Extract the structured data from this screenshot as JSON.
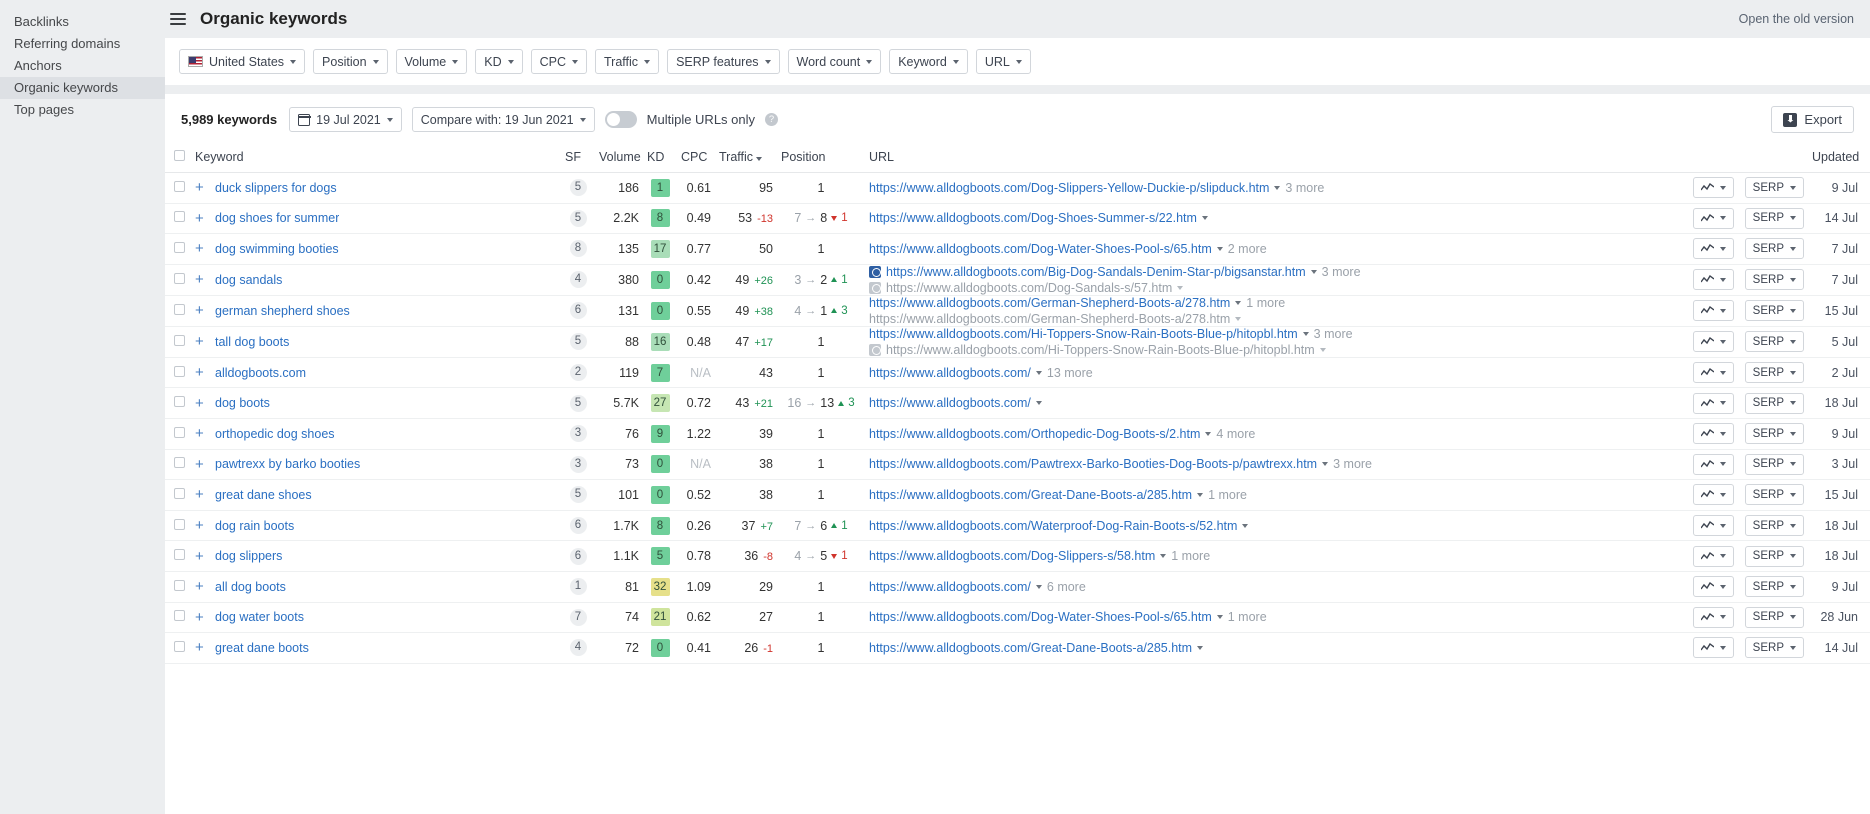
{
  "sidebar": {
    "items": [
      {
        "label": "Backlinks",
        "active": false
      },
      {
        "label": "Referring domains",
        "active": false
      },
      {
        "label": "Anchors",
        "active": false
      },
      {
        "label": "Organic keywords",
        "active": true
      },
      {
        "label": "Top pages",
        "active": false
      }
    ]
  },
  "header": {
    "title": "Organic keywords",
    "old_version_link": "Open the old version"
  },
  "filters": [
    {
      "label": "United States",
      "icon": "us-flag-icon",
      "name": "country"
    },
    {
      "label": "Position",
      "name": "position"
    },
    {
      "label": "Volume",
      "name": "volume"
    },
    {
      "label": "KD",
      "name": "kd"
    },
    {
      "label": "CPC",
      "name": "cpc"
    },
    {
      "label": "Traffic",
      "name": "traffic"
    },
    {
      "label": "SERP features",
      "name": "serp-features"
    },
    {
      "label": "Word count",
      "name": "word-count"
    },
    {
      "label": "Keyword",
      "name": "keyword"
    },
    {
      "label": "URL",
      "name": "url"
    }
  ],
  "toolbar": {
    "keyword_count": "5,989 keywords",
    "date": "19 Jul 2021",
    "compare": "Compare with: 19 Jun 2021",
    "multiple_urls_label": "Multiple URLs only",
    "multiple_urls_on": false,
    "export_label": "Export"
  },
  "table": {
    "columns": [
      {
        "key": "keyword",
        "label": "Keyword"
      },
      {
        "key": "sf",
        "label": "SF"
      },
      {
        "key": "volume",
        "label": "Volume"
      },
      {
        "key": "kd",
        "label": "KD"
      },
      {
        "key": "cpc",
        "label": "CPC"
      },
      {
        "key": "traffic",
        "label": "Traffic",
        "sorted": true
      },
      {
        "key": "position",
        "label": "Position"
      },
      {
        "key": "url",
        "label": "URL"
      },
      {
        "key": "updated",
        "label": "Updated"
      }
    ],
    "serp_button_label": "SERP",
    "rows": [
      {
        "keyword": "duck slippers for dogs",
        "sf": "5",
        "volume": "186",
        "kd": "1",
        "kd_color": "#6fcf9a",
        "cpc": "0.61",
        "traffic": "95",
        "traffic_delta": "",
        "traffic_delta_dir": "",
        "pos_from": "",
        "pos_to": "1",
        "pos_change": "",
        "pos_change_dir": "",
        "urls": [
          {
            "text": "https://www.alldogboots.com/Dog-Slippers-Yellow-Duckie-p/slipduck.htm",
            "more": "3 more",
            "serp_icon": "none",
            "muted": false
          }
        ],
        "updated": "9 Jul"
      },
      {
        "keyword": "dog shoes for summer",
        "sf": "5",
        "volume": "2.2K",
        "kd": "8",
        "kd_color": "#6fcf9a",
        "cpc": "0.49",
        "traffic": "53",
        "traffic_delta": "-13",
        "traffic_delta_dir": "down",
        "pos_from": "7",
        "pos_to": "8",
        "pos_change": "1",
        "pos_change_dir": "down",
        "urls": [
          {
            "text": "https://www.alldogboots.com/Dog-Shoes-Summer-s/22.htm",
            "more": "",
            "serp_icon": "none",
            "muted": false
          }
        ],
        "updated": "14 Jul"
      },
      {
        "keyword": "dog swimming booties",
        "sf": "8",
        "volume": "135",
        "kd": "17",
        "kd_color": "#a9ddb8",
        "cpc": "0.77",
        "traffic": "50",
        "traffic_delta": "",
        "traffic_delta_dir": "",
        "pos_from": "",
        "pos_to": "1",
        "pos_change": "",
        "pos_change_dir": "",
        "urls": [
          {
            "text": "https://www.alldogboots.com/Dog-Water-Shoes-Pool-s/65.htm",
            "more": "2 more",
            "serp_icon": "none",
            "muted": false
          }
        ],
        "updated": "7 Jul"
      },
      {
        "keyword": "dog sandals",
        "sf": "4",
        "volume": "380",
        "kd": "0",
        "kd_color": "#6fcf9a",
        "cpc": "0.42",
        "traffic": "49",
        "traffic_delta": "+26",
        "traffic_delta_dir": "up",
        "pos_from": "3",
        "pos_to": "2",
        "pos_change": "1",
        "pos_change_dir": "up",
        "urls": [
          {
            "text": "https://www.alldogboots.com/Big-Dog-Sandals-Denim-Star-p/bigsanstar.htm",
            "more": "3 more",
            "serp_icon": "blue",
            "muted": false
          },
          {
            "text": "https://www.alldogboots.com/Dog-Sandals-s/57.htm",
            "more": "",
            "serp_icon": "grey",
            "muted": true
          }
        ],
        "updated": "7 Jul"
      },
      {
        "keyword": "german shepherd shoes",
        "sf": "6",
        "volume": "131",
        "kd": "0",
        "kd_color": "#6fcf9a",
        "cpc": "0.55",
        "traffic": "49",
        "traffic_delta": "+38",
        "traffic_delta_dir": "up",
        "pos_from": "4",
        "pos_to": "1",
        "pos_change": "3",
        "pos_change_dir": "up",
        "urls": [
          {
            "text": "https://www.alldogboots.com/German-Shepherd-Boots-a/278.htm",
            "more": "1 more",
            "serp_icon": "none",
            "muted": false
          },
          {
            "text": "https://www.alldogboots.com/German-Shepherd-Boots-a/278.htm",
            "more": "",
            "serp_icon": "none",
            "muted": true
          }
        ],
        "updated": "15 Jul"
      },
      {
        "keyword": "tall dog boots",
        "sf": "5",
        "volume": "88",
        "kd": "16",
        "kd_color": "#a9ddb8",
        "cpc": "0.48",
        "traffic": "47",
        "traffic_delta": "+17",
        "traffic_delta_dir": "up",
        "pos_from": "",
        "pos_to": "1",
        "pos_change": "",
        "pos_change_dir": "",
        "urls": [
          {
            "text": "https://www.alldogboots.com/Hi-Toppers-Snow-Rain-Boots-Blue-p/hitopbl.htm",
            "more": "3 more",
            "serp_icon": "none",
            "muted": false
          },
          {
            "text": "https://www.alldogboots.com/Hi-Toppers-Snow-Rain-Boots-Blue-p/hitopbl.htm",
            "more": "",
            "serp_icon": "grey",
            "muted": true
          }
        ],
        "updated": "5 Jul"
      },
      {
        "keyword": "alldogboots.com",
        "sf": "2",
        "volume": "119",
        "kd": "7",
        "kd_color": "#6fcf9a",
        "cpc": "N/A",
        "traffic": "43",
        "traffic_delta": "",
        "traffic_delta_dir": "",
        "pos_from": "",
        "pos_to": "1",
        "pos_change": "",
        "pos_change_dir": "",
        "urls": [
          {
            "text": "https://www.alldogboots.com/",
            "more": "13 more",
            "serp_icon": "none",
            "muted": false
          }
        ],
        "updated": "2 Jul"
      },
      {
        "keyword": "dog boots",
        "sf": "5",
        "volume": "5.7K",
        "kd": "27",
        "kd_color": "#c6e6b3",
        "cpc": "0.72",
        "traffic": "43",
        "traffic_delta": "+21",
        "traffic_delta_dir": "up",
        "pos_from": "16",
        "pos_to": "13",
        "pos_change": "3",
        "pos_change_dir": "up",
        "urls": [
          {
            "text": "https://www.alldogboots.com/",
            "more": "",
            "serp_icon": "none",
            "muted": false
          }
        ],
        "updated": "18 Jul"
      },
      {
        "keyword": "orthopedic dog shoes",
        "sf": "3",
        "volume": "76",
        "kd": "9",
        "kd_color": "#6fcf9a",
        "cpc": "1.22",
        "traffic": "39",
        "traffic_delta": "",
        "traffic_delta_dir": "",
        "pos_from": "",
        "pos_to": "1",
        "pos_change": "",
        "pos_change_dir": "",
        "urls": [
          {
            "text": "https://www.alldogboots.com/Orthopedic-Dog-Boots-s/2.htm",
            "more": "4 more",
            "serp_icon": "none",
            "muted": false
          }
        ],
        "updated": "9 Jul"
      },
      {
        "keyword": "pawtrexx by barko booties",
        "sf": "3",
        "volume": "73",
        "kd": "0",
        "kd_color": "#6fcf9a",
        "cpc": "N/A",
        "traffic": "38",
        "traffic_delta": "",
        "traffic_delta_dir": "",
        "pos_from": "",
        "pos_to": "1",
        "pos_change": "",
        "pos_change_dir": "",
        "urls": [
          {
            "text": "https://www.alldogboots.com/Pawtrexx-Barko-Booties-Dog-Boots-p/pawtrexx.htm",
            "more": "3 more",
            "serp_icon": "none",
            "muted": false
          }
        ],
        "updated": "3 Jul"
      },
      {
        "keyword": "great dane shoes",
        "sf": "5",
        "volume": "101",
        "kd": "0",
        "kd_color": "#6fcf9a",
        "cpc": "0.52",
        "traffic": "38",
        "traffic_delta": "",
        "traffic_delta_dir": "",
        "pos_from": "",
        "pos_to": "1",
        "pos_change": "",
        "pos_change_dir": "",
        "urls": [
          {
            "text": "https://www.alldogboots.com/Great-Dane-Boots-a/285.htm",
            "more": "1 more",
            "serp_icon": "none",
            "muted": false
          }
        ],
        "updated": "15 Jul"
      },
      {
        "keyword": "dog rain boots",
        "sf": "6",
        "volume": "1.7K",
        "kd": "8",
        "kd_color": "#6fcf9a",
        "cpc": "0.26",
        "traffic": "37",
        "traffic_delta": "+7",
        "traffic_delta_dir": "up",
        "pos_from": "7",
        "pos_to": "6",
        "pos_change": "1",
        "pos_change_dir": "up",
        "urls": [
          {
            "text": "https://www.alldogboots.com/Waterproof-Dog-Rain-Boots-s/52.htm",
            "more": "",
            "serp_icon": "none",
            "muted": false
          }
        ],
        "updated": "18 Jul"
      },
      {
        "keyword": "dog slippers",
        "sf": "6",
        "volume": "1.1K",
        "kd": "5",
        "kd_color": "#6fcf9a",
        "cpc": "0.78",
        "traffic": "36",
        "traffic_delta": "-8",
        "traffic_delta_dir": "down",
        "pos_from": "4",
        "pos_to": "5",
        "pos_change": "1",
        "pos_change_dir": "down",
        "urls": [
          {
            "text": "https://www.alldogboots.com/Dog-Slippers-s/58.htm",
            "more": "1 more",
            "serp_icon": "none",
            "muted": false
          }
        ],
        "updated": "18 Jul"
      },
      {
        "keyword": "all dog boots",
        "sf": "1",
        "volume": "81",
        "kd": "32",
        "kd_color": "#e6e08a",
        "cpc": "1.09",
        "traffic": "29",
        "traffic_delta": "",
        "traffic_delta_dir": "",
        "pos_from": "",
        "pos_to": "1",
        "pos_change": "",
        "pos_change_dir": "",
        "urls": [
          {
            "text": "https://www.alldogboots.com/",
            "more": "6 more",
            "serp_icon": "none",
            "muted": false
          }
        ],
        "updated": "9 Jul"
      },
      {
        "keyword": "dog water boots",
        "sf": "7",
        "volume": "74",
        "kd": "21",
        "kd_color": "#cfe49c",
        "cpc": "0.62",
        "traffic": "27",
        "traffic_delta": "",
        "traffic_delta_dir": "",
        "pos_from": "",
        "pos_to": "1",
        "pos_change": "",
        "pos_change_dir": "",
        "urls": [
          {
            "text": "https://www.alldogboots.com/Dog-Water-Shoes-Pool-s/65.htm",
            "more": "1 more",
            "serp_icon": "none",
            "muted": false
          }
        ],
        "updated": "28 Jun"
      },
      {
        "keyword": "great dane boots",
        "sf": "4",
        "volume": "72",
        "kd": "0",
        "kd_color": "#6fcf9a",
        "cpc": "0.41",
        "traffic": "26",
        "traffic_delta": "-1",
        "traffic_delta_dir": "down",
        "pos_from": "",
        "pos_to": "1",
        "pos_change": "",
        "pos_change_dir": "",
        "urls": [
          {
            "text": "https://www.alldogboots.com/Great-Dane-Boots-a/285.htm",
            "more": "",
            "serp_icon": "none",
            "muted": false
          }
        ],
        "updated": "14 Jul"
      }
    ]
  }
}
